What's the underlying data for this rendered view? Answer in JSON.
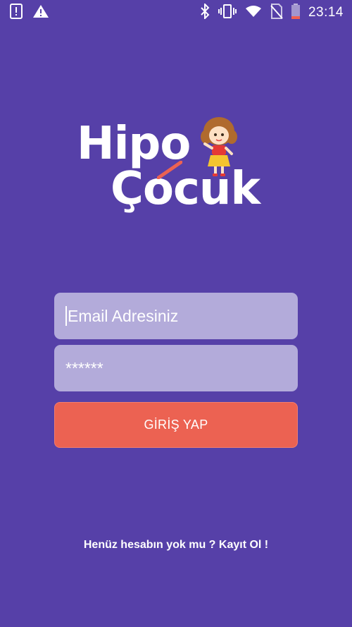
{
  "status_bar": {
    "time": "23:14",
    "left_icons": [
      "phone-alert-icon",
      "warning-icon"
    ],
    "right_icons": [
      "bluetooth-icon",
      "vibrate-icon",
      "wifi-icon",
      "no-sim-icon",
      "battery-icon"
    ]
  },
  "logo": {
    "line1": "Hipo",
    "line2": "Çocuk"
  },
  "login_form": {
    "email_placeholder": "Email Adresiniz",
    "password_value": "******",
    "submit_label": "GİRİŞ YAP"
  },
  "footer": {
    "register_text": "Henüz hesabın yok mu ? Kayıt Ol !"
  },
  "colors": {
    "background": "#5640a8",
    "field_background": "#b3abda",
    "button_background": "#ec6252",
    "text": "#ffffff"
  }
}
